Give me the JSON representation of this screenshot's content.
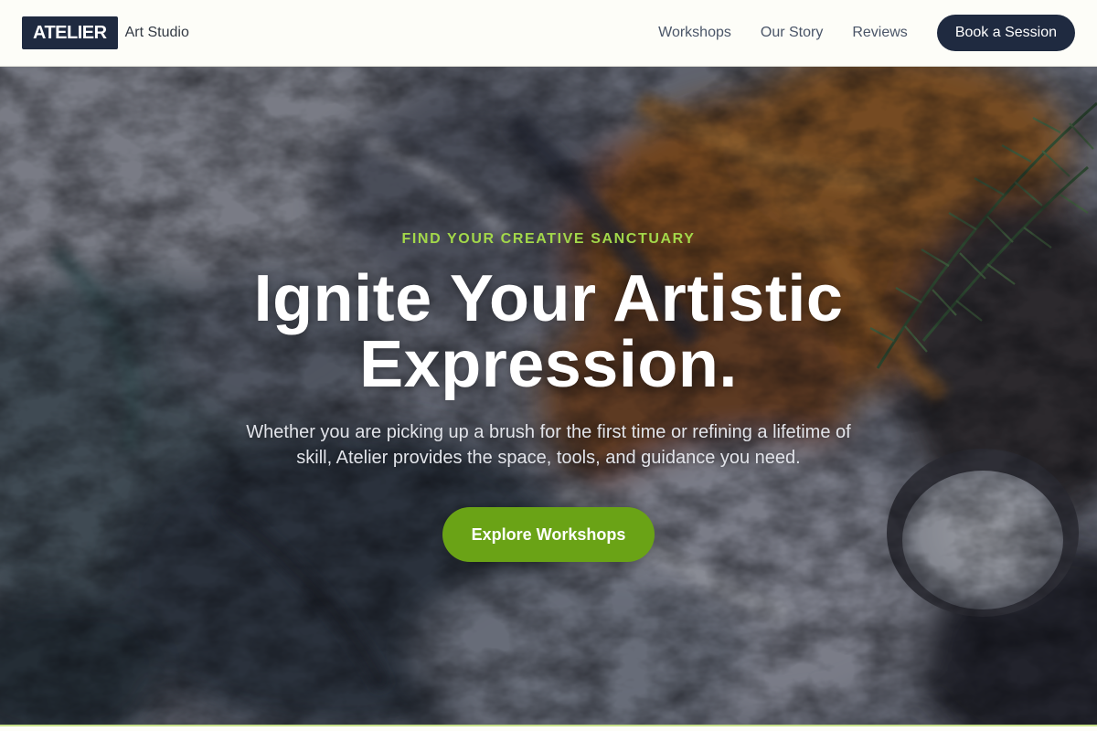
{
  "brand": {
    "logo": "ATELIER",
    "tagline": "Art Studio"
  },
  "nav": {
    "links": [
      "Workshops",
      "Our Story",
      "Reviews"
    ],
    "cta": "Book a Session"
  },
  "hero": {
    "eyebrow": "FIND YOUR CREATIVE SANCTUARY",
    "headline_line1": "Ignite Your Artistic",
    "headline_line2": "Expression.",
    "subtext": "Whether you are picking up a brush for the first time or refining a lifetime of skill, Atelier provides the space, tools, and guidance you need.",
    "cta": "Explore Workshops",
    "background": "textured-paint-palette-image"
  },
  "colors": {
    "navy": "#1f2a40",
    "accent_green": "#6aa316",
    "eyebrow_green": "#a3d84a",
    "page_bg": "#fdfdf8"
  }
}
